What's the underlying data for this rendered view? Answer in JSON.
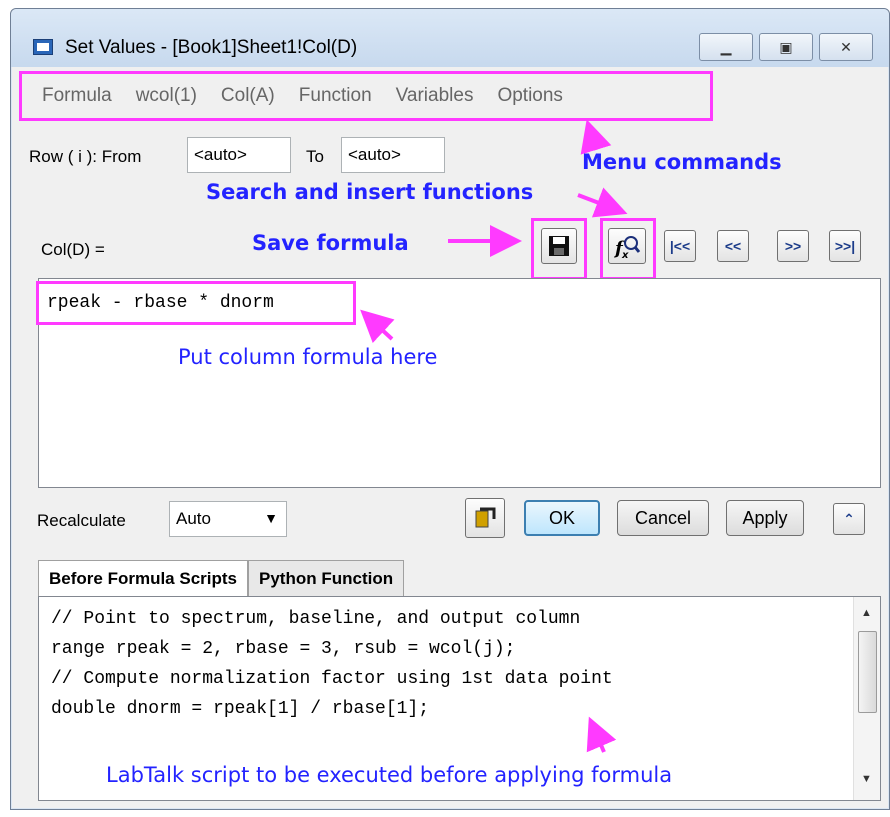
{
  "window": {
    "title": "Set Values - [Book1]Sheet1!Col(D)",
    "minimize_glyph": "▁",
    "maximize_glyph": "▣",
    "close_glyph": "✕"
  },
  "menu": {
    "items": [
      "Formula",
      "wcol(1)",
      "Col(A)",
      "Function",
      "Variables",
      "Options"
    ]
  },
  "row_range": {
    "label": "Row ( i ):  From",
    "from": "<auto>",
    "to_label": "To",
    "to": "<auto>"
  },
  "formula_label": "Col(D) =",
  "nav_buttons": [
    "|<<",
    "<<",
    ">>",
    ">>|"
  ],
  "formula_text": "rpeak - rbase * dnorm",
  "recalculate": {
    "label": "Recalculate",
    "value": "Auto"
  },
  "buttons": {
    "ok": "OK",
    "cancel": "Cancel",
    "apply": "Apply",
    "collapse": "⌃"
  },
  "tabs": [
    "Before Formula Scripts",
    "Python Function"
  ],
  "script_lines": [
    "// Point to spectrum, baseline, and output column",
    "range rpeak = 2, rbase = 3, rsub = wcol(j);",
    "// Compute normalization factor using 1st data point",
    "double dnorm = rpeak[1] / rbase[1];"
  ],
  "annotations": {
    "menu_commands": "Menu commands",
    "search_insert": "Search and insert functions",
    "save_formula": "Save formula",
    "column_formula": "Put column formula here",
    "labtalk": "LabTalk script to be executed before applying formula"
  },
  "colors": {
    "highlight": "#ff3aff",
    "annotation_text": "#2323ff",
    "arrow": "#ff3aff"
  }
}
